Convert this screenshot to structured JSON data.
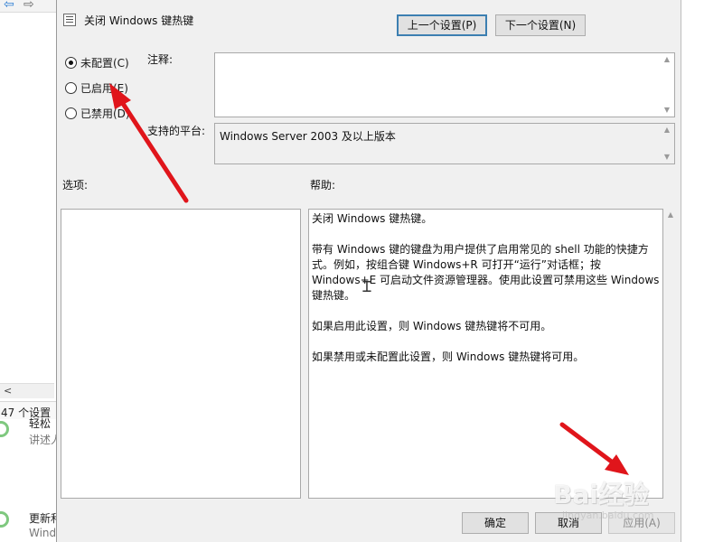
{
  "background_window": {
    "status_count": "47 个设置",
    "items": [
      {
        "title": "轻松",
        "subtitle": "讲述人"
      },
      {
        "title": "更新和",
        "subtitle": "Wind"
      }
    ]
  },
  "dialog": {
    "title": "关闭 Windows 键热键",
    "prev_button": "上一个设置(P)",
    "next_button": "下一个设置(N)",
    "radios": [
      {
        "label": "未配置(C)",
        "checked": true
      },
      {
        "label": "已启用(E)",
        "checked": false
      },
      {
        "label": "已禁用(D)",
        "checked": false
      }
    ],
    "comment_label": "注释:",
    "comment_value": "",
    "platform_label": "支持的平台:",
    "platform_value": "Windows Server 2003 及以上版本",
    "options_label": "选项:",
    "help_label": "帮助:",
    "help_paragraphs": [
      "关闭 Windows 键热键。",
      "带有 Windows 键的键盘为用户提供了启用常见的 shell 功能的快捷方式。例如，按组合键 Windows+R 可打开“运行”对话框；按 Windows+E 可启动文件资源管理器。使用此设置可禁用这些 Windows 键热键。",
      "如果启用此设置，则 Windows 键热键将不可用。",
      "如果禁用或未配置此设置，则 Windows 键热键将可用。"
    ],
    "ok_button": "确定",
    "cancel_button": "取消",
    "apply_button": "应用(A)"
  },
  "watermark": {
    "logo": "Bai经验",
    "url": "jingyan.baidu.com"
  },
  "colors": {
    "arrow": "#e0151b",
    "dialog_bg": "#f0f0f0",
    "default_button_border": "#3c7fb1"
  },
  "icons": {
    "title_icon": "policy-settings-icon",
    "back": "back-arrow-icon",
    "forward": "forward-arrow-icon"
  }
}
